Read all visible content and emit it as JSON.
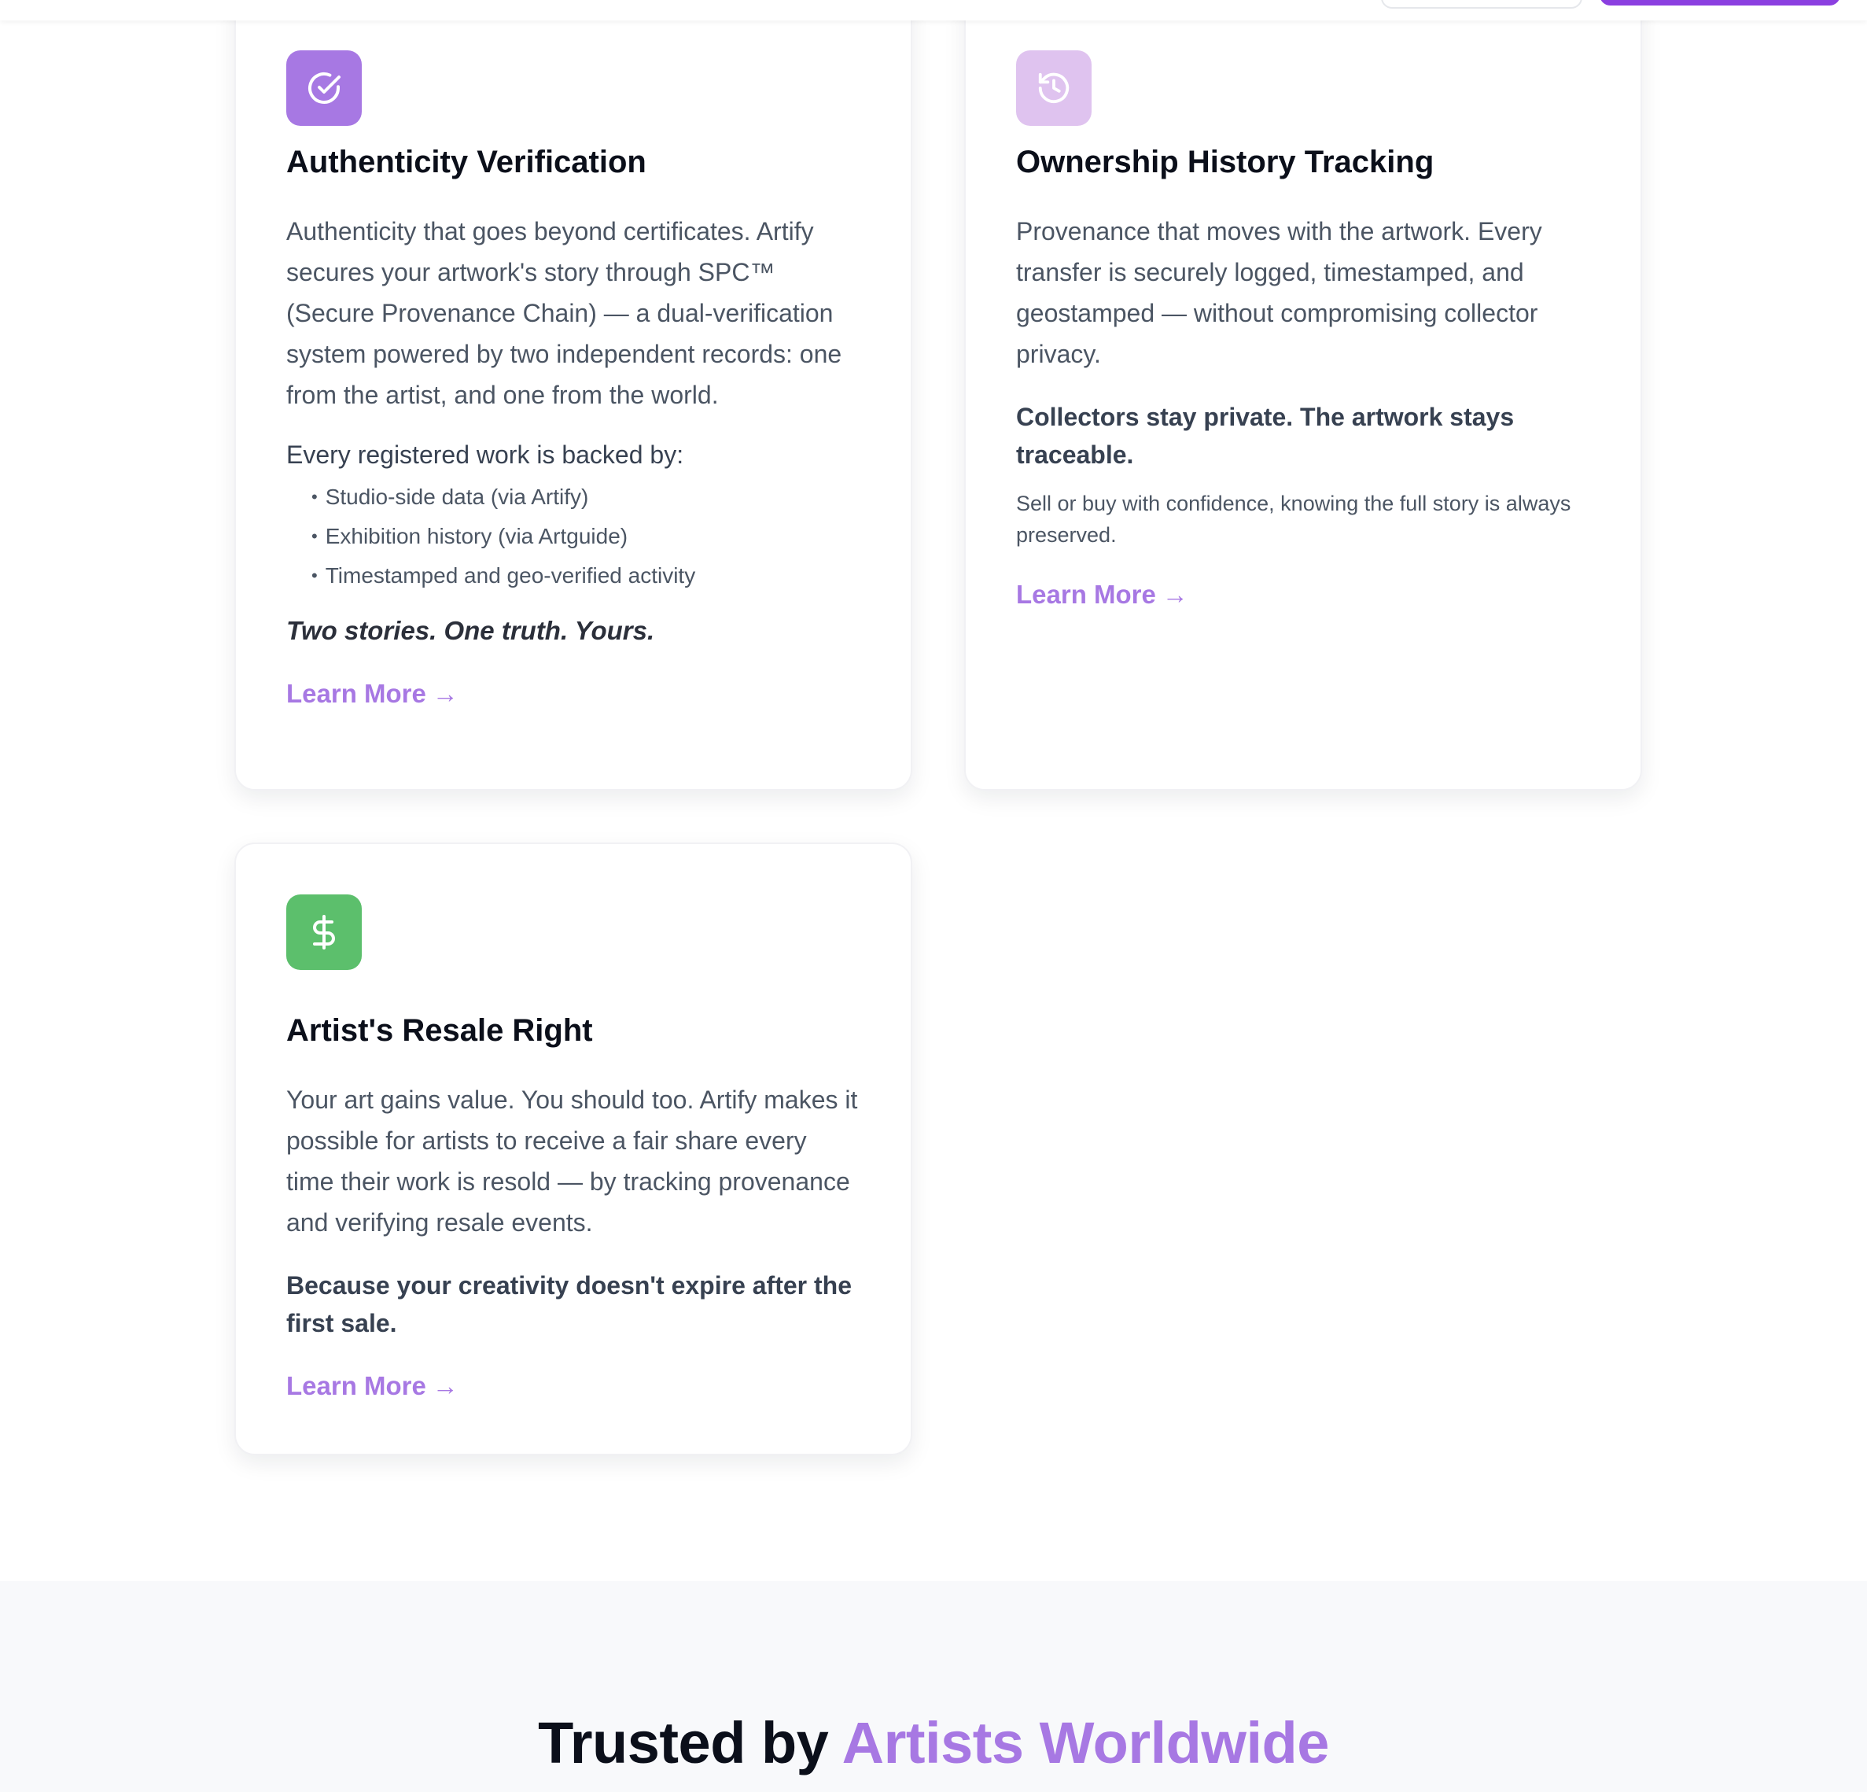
{
  "cards": [
    {
      "icon": "check-circle-icon",
      "icon_color": "#a778e3",
      "title": "Authenticity Verification",
      "description": "Authenticity that goes beyond certificates. Artify secures your artwork's story through SPC™ (Secure Provenance Chain) — a dual-verification system powered by two independent records: one from the artist, and one from the world.",
      "backed_by": "Every registered work is backed by:",
      "bullets": [
        "Studio-side data (via Artify)",
        "Exhibition history (via Artguide)",
        "Timestamped and geo-verified activity"
      ],
      "tagline": "Two stories. One truth. Yours.",
      "link": "Learn More",
      "arrow": "→"
    },
    {
      "icon": "history-icon",
      "icon_color": "#dfc3ef",
      "title": "Ownership History Tracking",
      "description": "Provenance that moves with the artwork. Every transfer is securely logged, timestamped, and geostamped — without compromising collector privacy.",
      "bold_note": "Collectors stay private. The artwork stays traceable.",
      "small_note": "Sell or buy with confidence, knowing the full story is always preserved.",
      "link": "Learn More",
      "arrow": "→"
    },
    {
      "icon": "dollar-icon",
      "icon_color": "#5cbf6c",
      "title": "Artist's Resale Right",
      "description": "Your art gains value. You should too. Artify makes it possible for artists to receive a fair share every time their work is resold — by tracking provenance and verifying resale events.",
      "bold_note": "Because your creativity doesn't expire after the first sale.",
      "link": "Learn More",
      "arrow": "→"
    }
  ],
  "trusted": {
    "prefix": "Trusted by",
    "accent": "Artists Worldwide"
  },
  "colors": {
    "accent": "#a778e3",
    "brand_button": "#8b3fe0"
  }
}
